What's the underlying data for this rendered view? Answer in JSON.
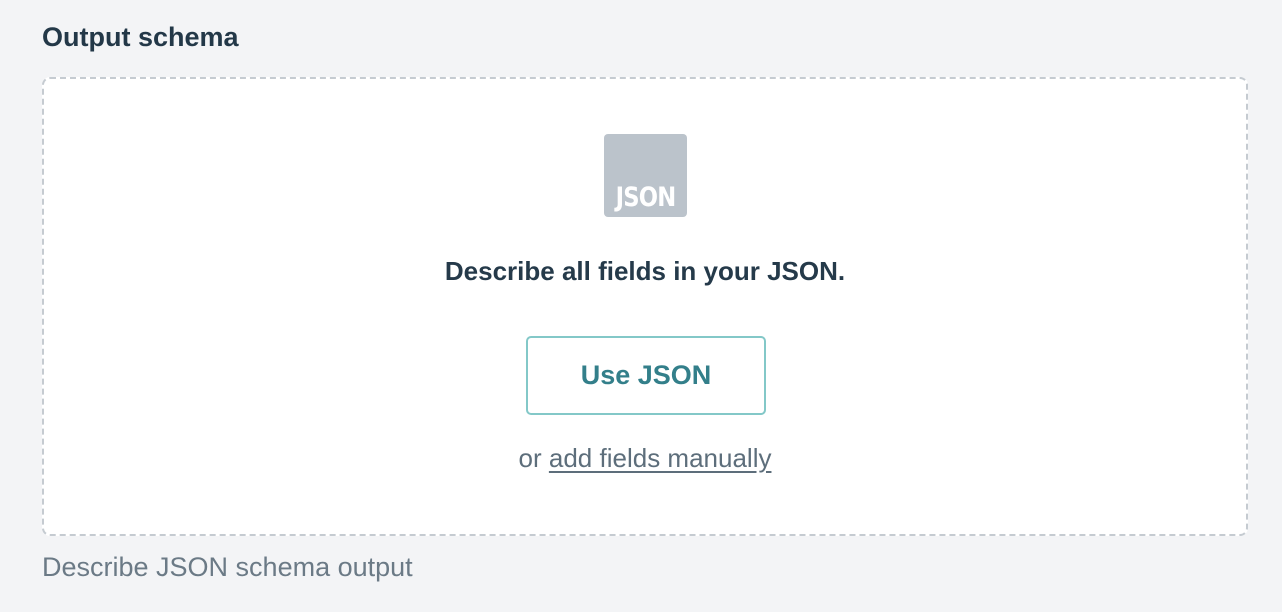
{
  "section": {
    "title": "Output schema"
  },
  "dropzone": {
    "icon": {
      "name": "json-file-icon",
      "label": "JSON"
    },
    "heading": "Describe all fields in your JSON.",
    "primary_button_label": "Use JSON",
    "alt_prefix": "or",
    "alt_link_label": "add fields manually"
  },
  "hint": "Describe JSON schema output",
  "colors": {
    "background": "#f3f4f6",
    "title_text": "#233848",
    "button_text": "#337f8a",
    "button_border": "#83c8c8",
    "icon_fill": "#bbc3cb",
    "muted_text": "#6b7a86"
  }
}
